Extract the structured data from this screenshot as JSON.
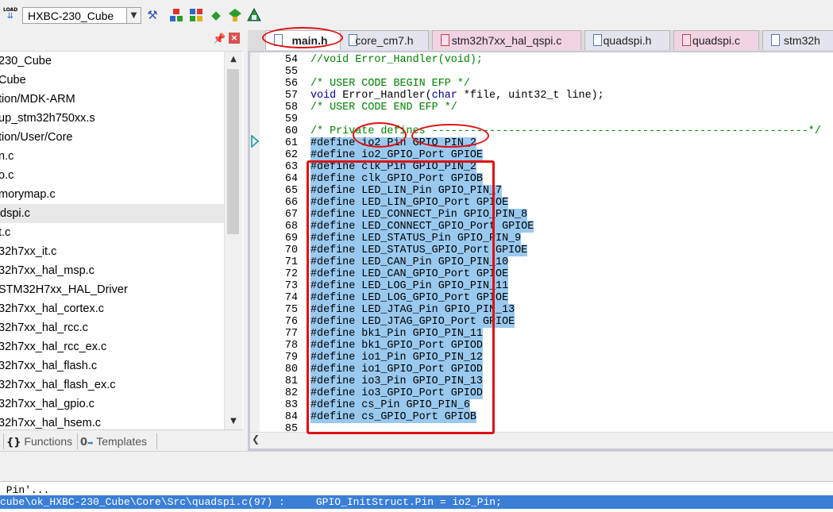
{
  "toolbar": {
    "load_label": "LOAD",
    "target": "HXBC-230_Cube",
    "icons": [
      "load-icon",
      "dropdown-arrow-icon",
      "target-options-icon",
      "manage-project-icon",
      "pack-installer-icon",
      "green-diamond-icon",
      "select-packs-icon",
      "run-env-icon"
    ]
  },
  "project_panel": {
    "items": [
      "230_Cube",
      "Cube",
      "tion/MDK-ARM",
      "up_stm32h750xx.s",
      "tion/User/Core",
      "n.c",
      "o.c",
      "morymap.c",
      "dspi.c",
      "t.c",
      "32h7xx_it.c",
      "32h7xx_hal_msp.c",
      "STM32H7xx_HAL_Driver",
      "32h7xx_hal_cortex.c",
      "32h7xx_hal_rcc.c",
      "32h7xx_hal_rcc_ex.c",
      "32h7xx_hal_flash.c",
      "32h7xx_hal_flash_ex.c",
      "32h7xx_hal_gpio.c",
      "32h7xx_hal_hsem.c"
    ],
    "selected_index": 8,
    "bottom_tabs": {
      "functions": "Functions",
      "templates": "Templates",
      "functions_glyph": "{}",
      "templates_glyph": "0"
    }
  },
  "editor": {
    "tabs": [
      {
        "label": "main.h",
        "active": true
      },
      {
        "label": "core_cm7.h",
        "active": false
      },
      {
        "label": "stm32h7xx_hal_qspi.c",
        "active": false
      },
      {
        "label": "quadspi.h",
        "active": false
      },
      {
        "label": "quadspi.c",
        "active": false
      },
      {
        "label": "stm32h",
        "active": false
      }
    ],
    "current_line": 61,
    "lines": [
      {
        "n": "54",
        "t": "//void Error_Handler(void);",
        "kind": "comment",
        "sel": false
      },
      {
        "n": "55",
        "t": "",
        "kind": "plain",
        "sel": false
      },
      {
        "n": "56",
        "t": "/* USER CODE BEGIN EFP */",
        "kind": "comment",
        "sel": false
      },
      {
        "n": "57",
        "t": "void Error_Handler(char *file, uint32_t line);",
        "kind": "mixed",
        "sel": false
      },
      {
        "n": "58",
        "t": "/* USER CODE END EFP */",
        "kind": "comment",
        "sel": false
      },
      {
        "n": "59",
        "t": "",
        "kind": "plain",
        "sel": false
      },
      {
        "n": "60",
        "t": "/* Private defines -----------------------------------------------------------*/",
        "kind": "comment",
        "sel": false
      },
      {
        "n": "61",
        "t": "#define io2_Pin GPIO_PIN_2",
        "kind": "plain",
        "sel": true
      },
      {
        "n": "62",
        "t": "#define io2_GPIO_Port GPIOE",
        "kind": "plain",
        "sel": true
      },
      {
        "n": "63",
        "t": "#define clk_Pin GPIO_PIN_2",
        "kind": "plain",
        "sel": true
      },
      {
        "n": "64",
        "t": "#define clk_GPIO_Port GPIOB",
        "kind": "plain",
        "sel": true
      },
      {
        "n": "65",
        "t": "#define LED_LIN_Pin GPIO_PIN_7",
        "kind": "plain",
        "sel": true
      },
      {
        "n": "66",
        "t": "#define LED_LIN_GPIO_Port GPIOE",
        "kind": "plain",
        "sel": true
      },
      {
        "n": "67",
        "t": "#define LED_CONNECT_Pin GPIO_PIN_8",
        "kind": "plain",
        "sel": true
      },
      {
        "n": "68",
        "t": "#define LED_CONNECT_GPIO_Port GPIOE",
        "kind": "plain",
        "sel": true
      },
      {
        "n": "69",
        "t": "#define LED_STATUS_Pin GPIO_PIN_9",
        "kind": "plain",
        "sel": true
      },
      {
        "n": "70",
        "t": "#define LED_STATUS_GPIO_Port GPIOE",
        "kind": "plain",
        "sel": true
      },
      {
        "n": "71",
        "t": "#define LED_CAN_Pin GPIO_PIN_10",
        "kind": "plain",
        "sel": true
      },
      {
        "n": "72",
        "t": "#define LED_CAN_GPIO_Port GPIOE",
        "kind": "plain",
        "sel": true
      },
      {
        "n": "73",
        "t": "#define LED_LOG_Pin GPIO_PIN_11",
        "kind": "plain",
        "sel": true
      },
      {
        "n": "74",
        "t": "#define LED_LOG_GPIO_Port GPIOE",
        "kind": "plain",
        "sel": true
      },
      {
        "n": "75",
        "t": "#define LED_JTAG_Pin GPIO_PIN_13",
        "kind": "plain",
        "sel": true
      },
      {
        "n": "76",
        "t": "#define LED_JTAG_GPIO_Port GPIOE",
        "kind": "plain",
        "sel": true
      },
      {
        "n": "77",
        "t": "#define bk1_Pin GPIO_PIN_11",
        "kind": "plain",
        "sel": true
      },
      {
        "n": "78",
        "t": "#define bk1_GPIO_Port GPIOD",
        "kind": "plain",
        "sel": true
      },
      {
        "n": "79",
        "t": "#define io1_Pin GPIO_PIN_12",
        "kind": "plain",
        "sel": true
      },
      {
        "n": "80",
        "t": "#define io1_GPIO_Port GPIOD",
        "kind": "plain",
        "sel": true
      },
      {
        "n": "81",
        "t": "#define io3_Pin GPIO_PIN_13",
        "kind": "plain",
        "sel": true
      },
      {
        "n": "82",
        "t": "#define io3_GPIO_Port GPIOD",
        "kind": "plain",
        "sel": true
      },
      {
        "n": "83",
        "t": "#define cs_Pin GPIO_PIN_6",
        "kind": "plain",
        "sel": true
      },
      {
        "n": "84",
        "t": "#define cs_GPIO_Port GPIOB",
        "kind": "plain",
        "sel": true
      },
      {
        "n": "85",
        "t": "",
        "kind": "plain",
        "sel": false
      }
    ],
    "line57_parts": {
      "void": "void",
      "a": " Error_Handler(",
      "char": "char",
      "b": " *file, uint32_t line);"
    }
  },
  "output": {
    "line1": " Pin'...",
    "line2": "cube\\ok_HXBC-230_Cube\\Core\\Src\\quadspi.c(97) :     GPIO_InitStruct.Pin = io2_Pin;"
  },
  "colors": {
    "selection": "#99c9ef",
    "comment": "#008000",
    "keyword": "#00008b",
    "annotation": "#e01010"
  }
}
